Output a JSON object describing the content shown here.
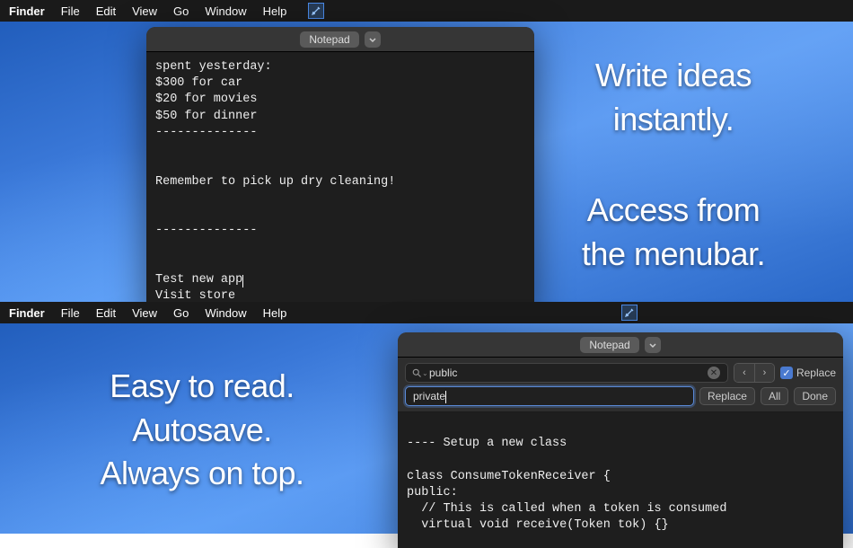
{
  "top": {
    "menubar": {
      "app": "Finder",
      "items": [
        "File",
        "Edit",
        "View",
        "Go",
        "Window",
        "Help"
      ]
    },
    "window": {
      "title": "Notepad"
    },
    "editor_lines": [
      "spent yesterday:",
      "$300 for car",
      "$20 for movies",
      "$50 for dinner",
      "--------------",
      "",
      "",
      "Remember to pick up dry cleaning!",
      "",
      "",
      "--------------",
      "",
      "",
      "Test new app",
      "Visit store"
    ],
    "cursor_line_index": 13,
    "promo1_line1": "Write ideas",
    "promo1_line2": "instantly.",
    "promo2_line1": "Access from",
    "promo2_line2": "the menubar."
  },
  "bottom": {
    "menubar": {
      "app": "Finder",
      "items": [
        "File",
        "Edit",
        "View",
        "Go",
        "Window",
        "Help"
      ]
    },
    "window": {
      "title": "Notepad"
    },
    "find": {
      "search_value": "public",
      "replace_value": "private",
      "replace_check_label": "Replace",
      "prev": "‹",
      "next": "›",
      "replace_btn": "Replace",
      "all_btn": "All",
      "done_btn": "Done"
    },
    "editor_lines": [
      "",
      "---- Setup a new class",
      "",
      "class ConsumeTokenReceiver {",
      "public:",
      "  // This is called when a token is consumed",
      "  virtual void receive(Token tok) {}"
    ],
    "promo_line1": "Easy to read.",
    "promo_line2": "Autosave.",
    "promo_line3": "Always on top."
  }
}
